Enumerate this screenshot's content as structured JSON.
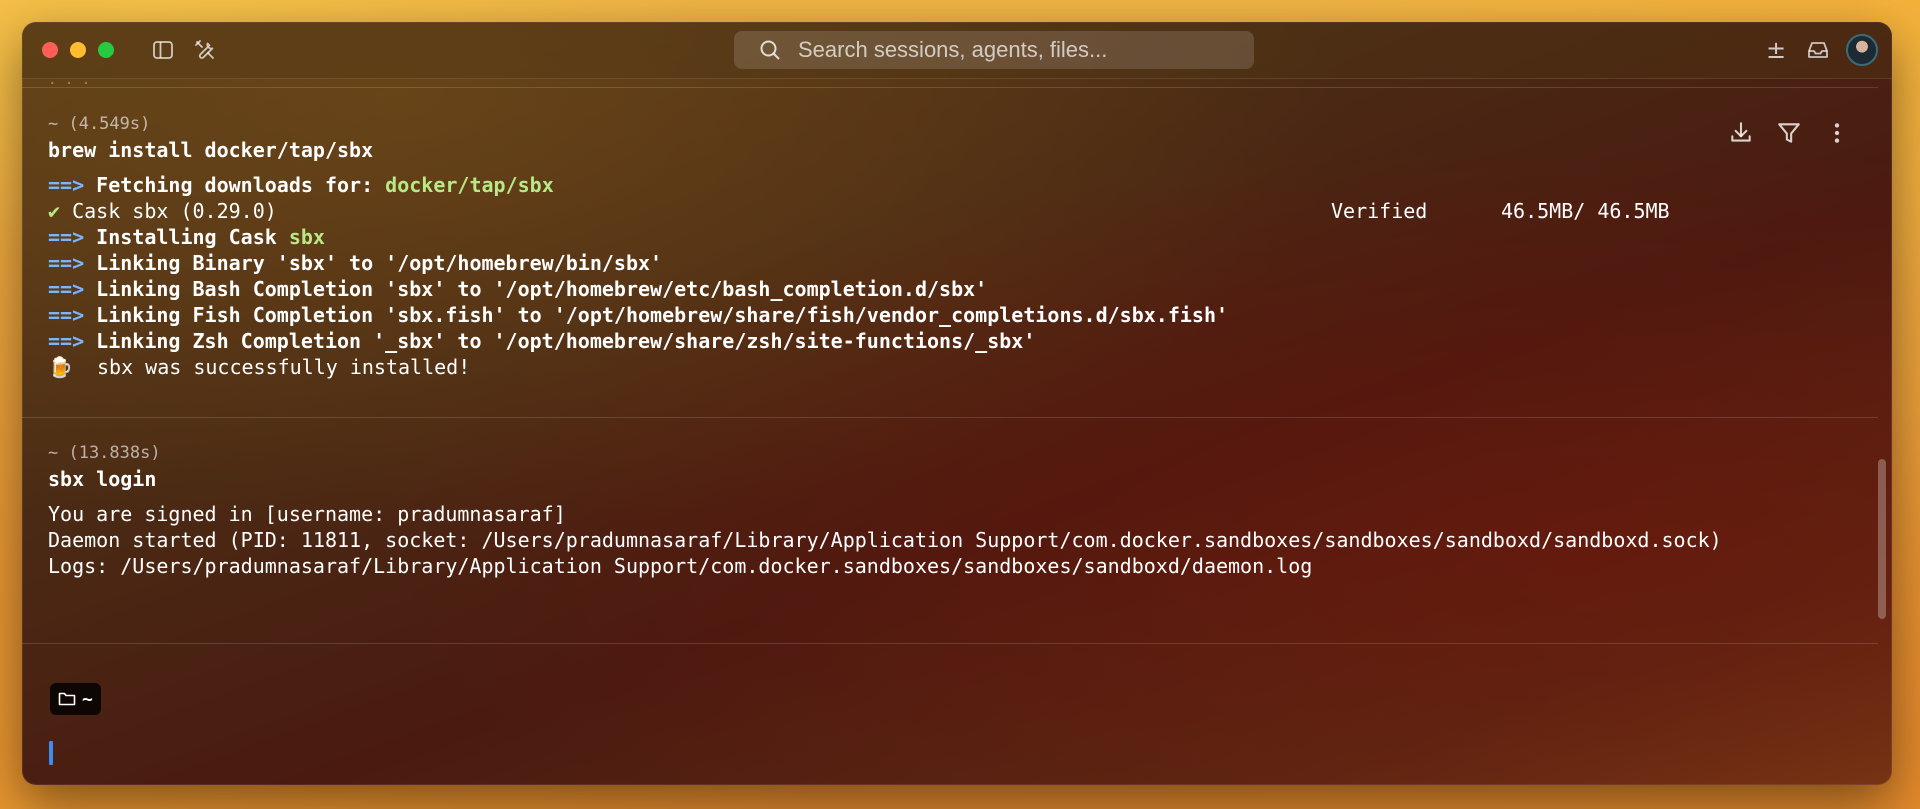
{
  "titlebar": {
    "search_placeholder": "Search sessions, agents, files...",
    "plus_minus_symbol": "±",
    "icons": [
      "sidebar-toggle-icon",
      "tools-icon",
      "search-icon",
      "plus-minus-icon",
      "inbox-icon",
      "avatar"
    ]
  },
  "blocks": [
    {
      "meta": "~ (4.549s)",
      "command": "brew install docker/tap/sbx",
      "lines": {
        "l1_arrow": "==>",
        "l1_text": " Fetching downloads for: ",
        "l1_green": "docker/tap/sbx",
        "l2_check": "✔",
        "l2_text": " Cask sbx (0.29.0)",
        "l2_verified": "Verified",
        "l2_size": "46.5MB/ 46.5MB",
        "l3_arrow": "==>",
        "l3_text": " Installing Cask ",
        "l3_green": "sbx",
        "l4_arrow": "==>",
        "l4_text": " Linking Binary 'sbx' to '/opt/homebrew/bin/sbx'",
        "l5_arrow": "==>",
        "l5_text": " Linking Bash Completion 'sbx' to '/opt/homebrew/etc/bash_completion.d/sbx'",
        "l6_arrow": "==>",
        "l6_text": " Linking Fish Completion 'sbx.fish' to '/opt/homebrew/share/fish/vendor_completions.d/sbx.fish'",
        "l7_arrow": "==>",
        "l7_text": " Linking Zsh Completion '_sbx' to '/opt/homebrew/share/zsh/site-functions/_sbx'",
        "l8_emoji": "🍺",
        "l8_text": "  sbx was successfully installed!"
      }
    },
    {
      "meta": "~ (13.838s)",
      "command": "sbx login",
      "lines": {
        "l1": "You are signed in [username: pradumnasaraf]",
        "l2": "Daemon started (PID: 11811, socket: /Users/pradumnasaraf/Library/Application Support/com.docker.sandboxes/sandboxes/sandboxd/sandboxd.sock)",
        "l3": "Logs: /Users/pradumnasaraf/Library/Application Support/com.docker.sandboxes/sandboxes/sandboxd/daemon.log"
      }
    }
  ],
  "prompt": {
    "dir": "~"
  }
}
